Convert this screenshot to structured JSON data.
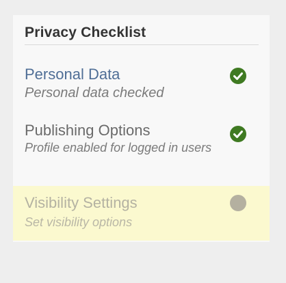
{
  "checklist": {
    "title": "Privacy Checklist",
    "items": [
      {
        "title": "Personal Data",
        "description": "Personal data checked",
        "status": "done",
        "status_icon": "checkmark-icon",
        "state": "complete"
      },
      {
        "title": "Publishing Options",
        "description": "Profile enabled for logged in users",
        "status": "done",
        "status_icon": "checkmark-icon",
        "state": "complete"
      },
      {
        "title": "Visibility Settings",
        "description": "Set visibility options",
        "status": "pending",
        "status_icon": "empty-circle-icon",
        "state": "active"
      }
    ]
  },
  "colors": {
    "check_green": "#3f7a22",
    "highlight_yellow": "#fbf9cf",
    "link_blue": "#4f6e96",
    "pending_gray": "#b4b0a0"
  }
}
